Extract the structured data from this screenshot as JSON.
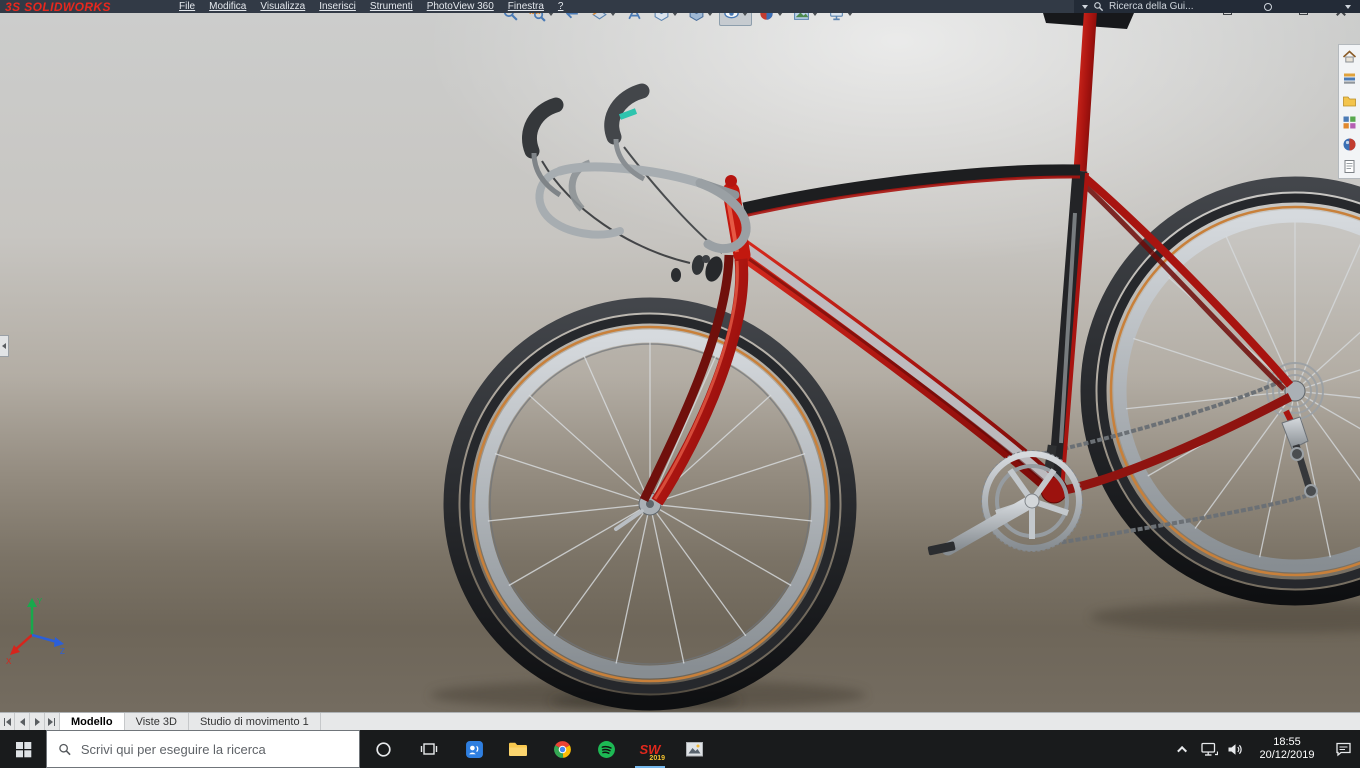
{
  "titlebar": {
    "logo_text": "3S SOLIDWORKS",
    "menus": [
      "File",
      "Modifica",
      "Visualizza",
      "Inserisci",
      "Strumenti",
      "PhotoView 360",
      "Finestra",
      "?"
    ],
    "search": {
      "placeholder": "Ricerca della Gui..."
    }
  },
  "window_controls": [
    "document-restore-icon",
    "minimize-icon",
    "restore-icon",
    "close-icon"
  ],
  "heads_up_toolbar": {
    "active_tool": "hide-show-items-icon",
    "tools": [
      "zoom-to-fit-icon",
      "zoom-to-area-icon",
      "previous-view-icon",
      "section-view-icon",
      "annotation-views-icon",
      "view-orientation-icon",
      "display-style-icon",
      "hide-show-items-icon",
      "edit-appearance-icon",
      "apply-scene-icon",
      "view-settings-icon"
    ]
  },
  "task_pane_icons": [
    "home-icon",
    "design-library-icon",
    "file-explorer-icon",
    "view-palette-icon",
    "appearances-scenes-icon",
    "custom-properties-icon"
  ],
  "viewport": {
    "triad": {
      "x": "X",
      "y": "Y",
      "z": "Z"
    }
  },
  "sheet_tabs": [
    {
      "label": "Modello",
      "active": true
    },
    {
      "label": "Viste 3D",
      "active": false
    },
    {
      "label": "Studio di movimento 1",
      "active": false
    }
  ],
  "taskbar": {
    "search_placeholder": "Scrivi qui per eseguire la ricerca",
    "icons": [
      "start-icon",
      "cortana-icon",
      "task-view-icon",
      "chat-app-icon",
      "file-explorer-icon",
      "chrome-icon",
      "spotify-icon",
      "solidworks-icon",
      "photos-icon"
    ],
    "solidworks_logo": "SW",
    "solidworks_year": "2019",
    "tray": {
      "time": "18:55",
      "date": "20/12/2019"
    }
  }
}
